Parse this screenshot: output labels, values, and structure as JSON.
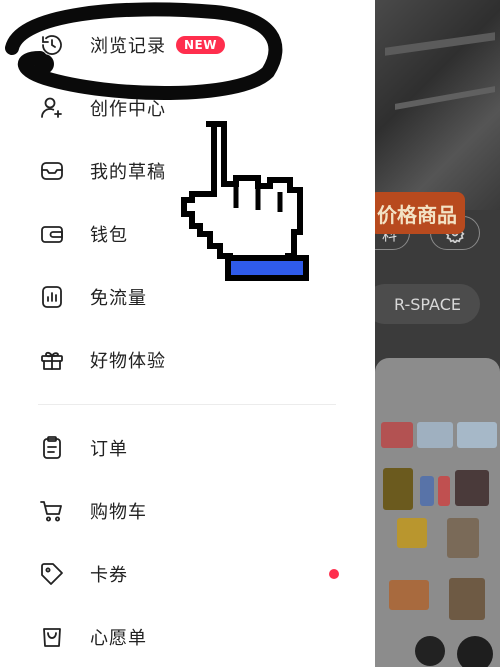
{
  "menu": {
    "items": [
      {
        "label": "浏览记录",
        "icon": "history-clock-icon",
        "badge": "NEW"
      },
      {
        "label": "创作中心",
        "icon": "user-star-icon"
      },
      {
        "label": "我的草稿",
        "icon": "drafts-box-icon"
      },
      {
        "label": "钱包",
        "icon": "wallet-icon"
      },
      {
        "label": "免流量",
        "icon": "data-free-icon"
      },
      {
        "label": "好物体验",
        "icon": "gift-icon"
      },
      {
        "label": "订单",
        "icon": "order-clipboard-icon"
      },
      {
        "label": "购物车",
        "icon": "cart-icon"
      },
      {
        "label": "卡券",
        "icon": "coupon-tag-icon",
        "dot": true
      },
      {
        "label": "心愿单",
        "icon": "wishlist-bag-icon"
      }
    ]
  },
  "background": {
    "pill_text": "料",
    "space_button": "R-SPACE",
    "promo_text": "价格商品"
  },
  "colors": {
    "accent": "#ff2e4d",
    "text": "#222222",
    "overlay": "#3b3b3b"
  }
}
